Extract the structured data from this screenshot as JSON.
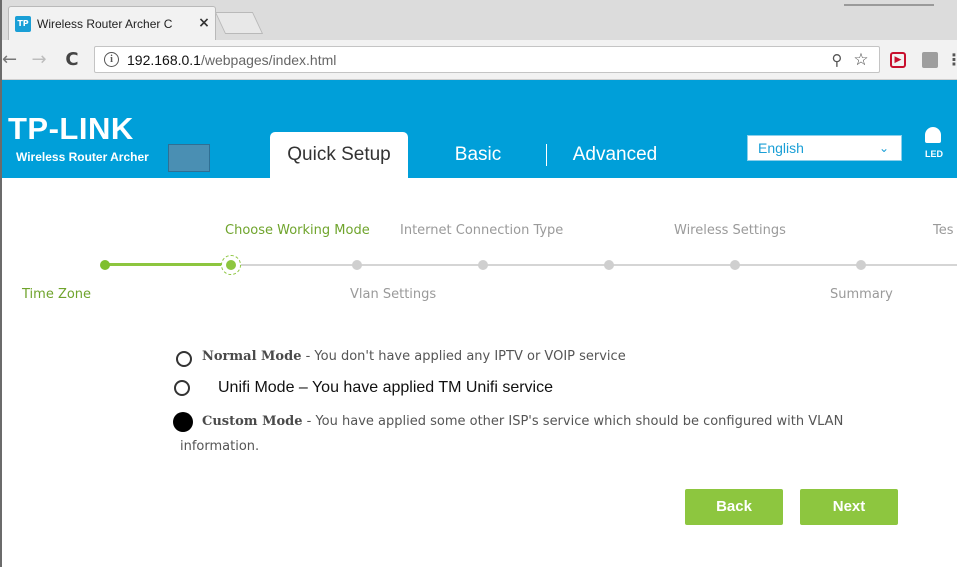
{
  "browser": {
    "tab_title": "Wireless Router Archer C",
    "favicon_text": "TP",
    "url_host": "192.168.0.1",
    "url_path": "/webpages/index.html",
    "icons": [
      "back-arrow-icon",
      "forward-arrow-icon",
      "reload-icon",
      "info-icon",
      "zoom-icon",
      "star-icon",
      "extension-icon",
      "menu-icon"
    ]
  },
  "header": {
    "brand": "TP-LINK",
    "subtitle": "Wireless Router Archer",
    "nav_tabs": [
      {
        "label": "Quick Setup",
        "active": true
      },
      {
        "label": "Basic",
        "active": false
      },
      {
        "label": "Advanced",
        "active": false
      }
    ],
    "language": "English",
    "led_label": "LED",
    "colors": {
      "header_bg": "#009fd9",
      "accent_green": "#8dc63f"
    }
  },
  "steps": {
    "top_labels": [
      "Choose Working Mode",
      "Internet Connection Type",
      "Wireless Settings",
      "Tes"
    ],
    "bottom_labels": [
      "Time Zone",
      "Vlan Settings",
      "Summary"
    ],
    "current_step": "Choose Working Mode"
  },
  "modes": {
    "normal": {
      "title": "Normal Mode",
      "desc": " - You don't have applied any IPTV or VOIP service"
    },
    "unifi": {
      "text": "Unifi Mode – You have applied TM Unifi service"
    },
    "custom": {
      "title": "Custom Mode",
      "desc": " - You have applied some other ISP's service which should be configured with VLAN",
      "desc_line2": "information."
    },
    "selected": "custom"
  },
  "buttons": {
    "back": "Back",
    "next": "Next"
  }
}
